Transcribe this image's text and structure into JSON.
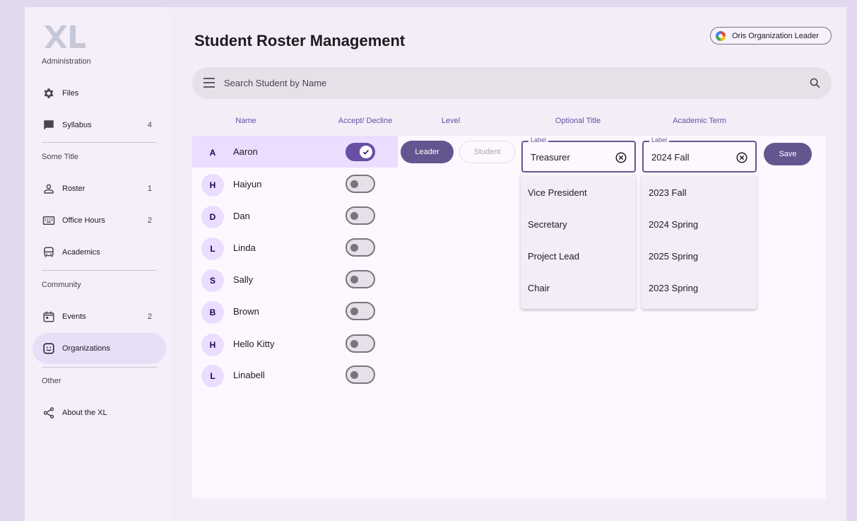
{
  "app": {
    "logo_text": "XL",
    "title": "Student Roster Management"
  },
  "user": {
    "role_label": "Oris Organization Leader"
  },
  "sidebar": {
    "heading_admin": "Administration",
    "heading_some": "Some Title",
    "heading_community": "Community",
    "heading_other": "Other",
    "items": [
      {
        "label": "Files",
        "count": "",
        "icon": "gear-icon"
      },
      {
        "label": "Syllabus",
        "count": "4",
        "icon": "chat-icon"
      },
      {
        "label": "Roster",
        "count": "1",
        "icon": "person-icon"
      },
      {
        "label": "Office Hours",
        "count": "2",
        "icon": "keyboard-icon"
      },
      {
        "label": "Academics",
        "count": "",
        "icon": "bus-icon"
      },
      {
        "label": "Events",
        "count": "2",
        "icon": "calendar-icon"
      },
      {
        "label": "Organizations",
        "count": "",
        "icon": "sticker-icon",
        "active": true
      },
      {
        "label": "About the XL",
        "count": "",
        "icon": "share-icon"
      }
    ]
  },
  "search": {
    "placeholder": "Search Student by Name"
  },
  "table": {
    "headers": {
      "name": "Name",
      "accept": "Accept/ Decline",
      "level": "Level",
      "title": "Optional Title",
      "term": "Academic Term"
    },
    "rows": [
      {
        "initial": "A",
        "name": "Aaron",
        "accepted": true
      },
      {
        "initial": "H",
        "name": "Haiyun",
        "accepted": false
      },
      {
        "initial": "D",
        "name": "Dan",
        "accepted": false
      },
      {
        "initial": "L",
        "name": "Linda",
        "accepted": false
      },
      {
        "initial": "S",
        "name": "Sally",
        "accepted": false
      },
      {
        "initial": "B",
        "name": "Brown",
        "accepted": false
      },
      {
        "initial": "H",
        "name": "Hello Kitty",
        "accepted": false
      },
      {
        "initial": "L",
        "name": "Linabell",
        "accepted": false
      }
    ]
  },
  "editor": {
    "leader_label": "Leader",
    "student_label": "Student",
    "save_label": "Save",
    "title_field": {
      "label": "Label",
      "value": "Treasurer"
    },
    "term_field": {
      "label": "Label",
      "value": "2024 Fall"
    },
    "title_options": [
      "Vice President",
      "Secretary",
      "Project Lead",
      "Chair"
    ],
    "term_options": [
      "2023 Fall",
      "2024 Spring",
      "2025 Spring",
      "2023 Spring"
    ]
  },
  "colors": {
    "accent": "#65558f",
    "selected_row": "#eaddff",
    "background": "#f3edf7"
  }
}
